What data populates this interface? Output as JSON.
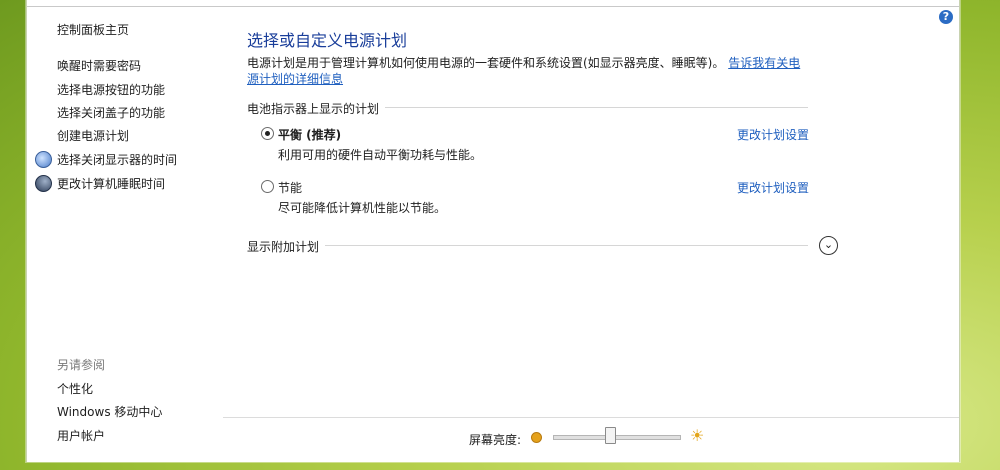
{
  "left": {
    "home": "控制面板主页",
    "tasks": [
      "唤醒时需要密码",
      "选择电源按钮的功能",
      "选择关闭盖子的功能",
      "创建电源计划",
      "选择关闭显示器的时间",
      "更改计算机睡眠时间"
    ],
    "see_also_title": "另请参阅",
    "see_also": [
      "个性化",
      "Windows 移动中心",
      "用户帐户"
    ]
  },
  "main": {
    "title": "选择或自定义电源计划",
    "desc": "电源计划是用于管理计算机如何使用电源的一套硬件和系统设置(如显示器亮度、睡眠等)。",
    "desc_link": "告诉我有关电源计划的详细信息",
    "battery_section": "电池指示器上显示的计划",
    "plans": [
      {
        "name": "平衡 (推荐)",
        "desc": "利用可用的硬件自动平衡功耗与性能。",
        "link": "更改计划设置",
        "selected": true
      },
      {
        "name": "节能",
        "desc": "尽可能降低计算机性能以节能。",
        "link": "更改计划设置",
        "selected": false
      }
    ],
    "more_section": "显示附加计划"
  },
  "footer": {
    "brightness_label": "屏幕亮度:",
    "brightness_level": 0.45
  },
  "help_glyph": "?",
  "expander_glyph": "⌄",
  "sun_glyph": "☀",
  "icons": {
    "help": "help-icon",
    "display": "monitor-icon",
    "sleep": "moon-icon",
    "expand": "chevron-down-icon"
  }
}
